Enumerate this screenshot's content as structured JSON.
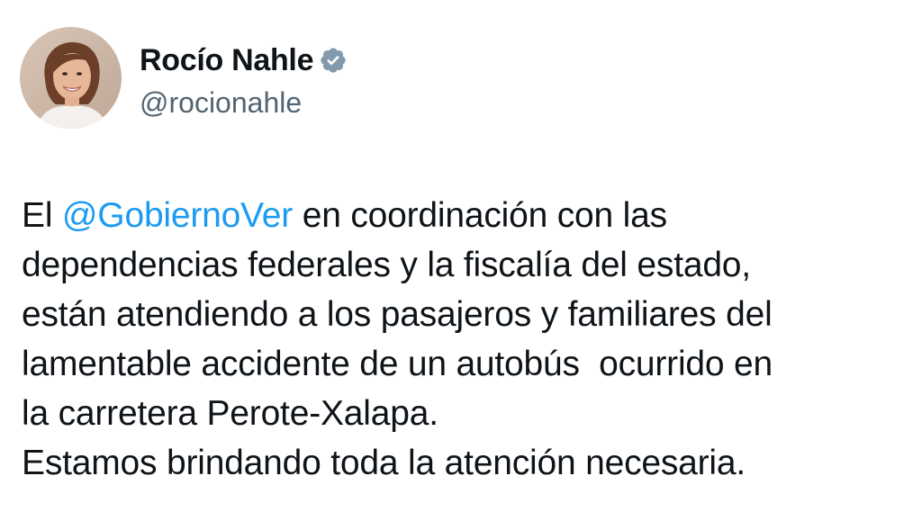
{
  "author": {
    "display_name": "Rocío Nahle",
    "handle": "@rocionahle",
    "verified": true,
    "verified_color": "#829aab",
    "avatar_icon": "profile-photo"
  },
  "tweet": {
    "line1_prefix": "El ",
    "mention": "@GobiernoVer",
    "line1_suffix": " en coordinación con las",
    "line2": "dependencias federales y la fiscalía del estado,",
    "line3": "están atendiendo a los pasajeros y familiares del",
    "line4": "lamentable accidente de un autobús  ocurrido en",
    "line5": "la carretera Perote-Xalapa.",
    "line6": "Estamos brindando toda la atención necesaria."
  },
  "colors": {
    "text": "#0f1419",
    "secondary": "#536471",
    "link": "#1d9bf0",
    "background": "#ffffff"
  }
}
